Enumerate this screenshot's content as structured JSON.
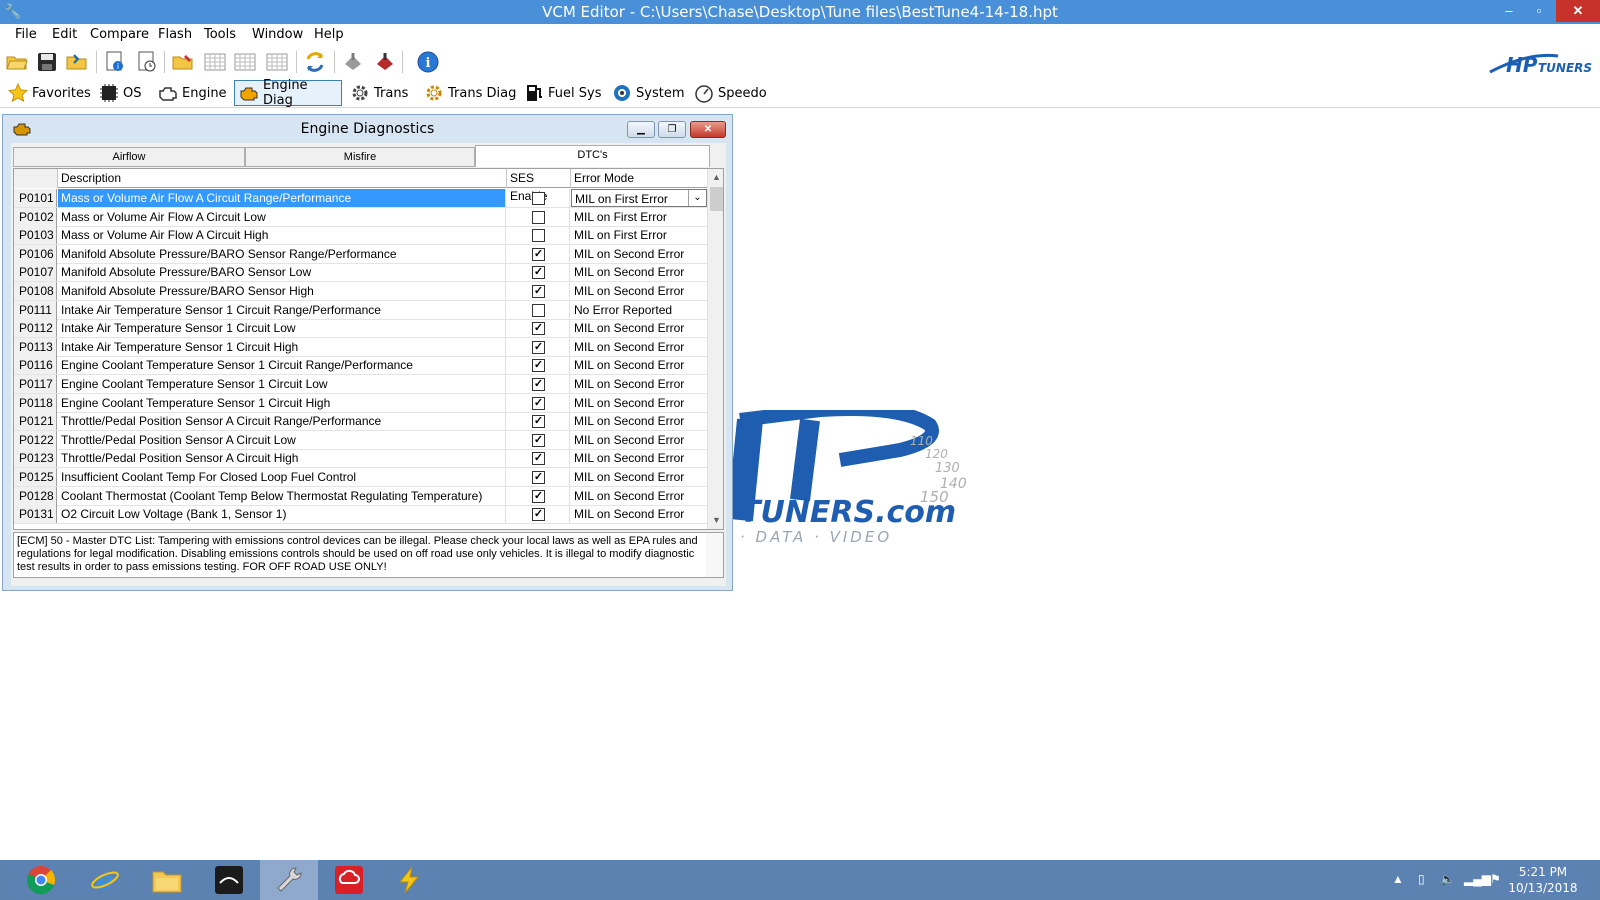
{
  "window": {
    "title": "VCM Editor - C:\\Users\\Chase\\Desktop\\Tune files\\BestTune4-14-18.hpt",
    "controls": [
      "–",
      "▫",
      "✕"
    ]
  },
  "menu": [
    "File",
    "Edit",
    "Compare",
    "Flash",
    "Tools",
    "Window",
    "Help"
  ],
  "brand": {
    "logo_text": "HPTUNERS",
    "accent": "#1a5fb4"
  },
  "nav": [
    {
      "label": "Favorites",
      "icon": "star-icon"
    },
    {
      "label": "OS",
      "icon": "chip-icon"
    },
    {
      "label": "Engine",
      "icon": "engine-icon"
    },
    {
      "label": "Engine Diag",
      "icon": "engine-check-icon",
      "active": true
    },
    {
      "label": "Trans",
      "icon": "gear-icon"
    },
    {
      "label": "Trans Diag",
      "icon": "gear-check-icon"
    },
    {
      "label": "Fuel Sys",
      "icon": "fuel-pump-icon"
    },
    {
      "label": "System",
      "icon": "system-icon"
    },
    {
      "label": "Speedo",
      "icon": "speedometer-icon"
    }
  ],
  "child": {
    "title": "Engine Diagnostics",
    "tabs": [
      "Airflow",
      "Misfire",
      "DTC's"
    ],
    "active_tab": "DTC's",
    "columns": {
      "code": "",
      "description": "Description",
      "ses": "SES Enable",
      "mode": "Error Mode"
    },
    "rows": [
      {
        "code": "P0101",
        "desc": "Mass or Volume Air Flow A Circuit Range/Performance",
        "ses": false,
        "mode": "MIL on First Error",
        "selected": true
      },
      {
        "code": "P0102",
        "desc": "Mass or Volume Air Flow A Circuit Low",
        "ses": false,
        "mode": "MIL on First Error"
      },
      {
        "code": "P0103",
        "desc": "Mass or Volume Air Flow A Circuit High",
        "ses": false,
        "mode": "MIL on First Error"
      },
      {
        "code": "P0106",
        "desc": "Manifold Absolute Pressure/BARO Sensor Range/Performance",
        "ses": true,
        "mode": "MIL on Second Error"
      },
      {
        "code": "P0107",
        "desc": "Manifold Absolute Pressure/BARO Sensor Low",
        "ses": true,
        "mode": "MIL on Second Error"
      },
      {
        "code": "P0108",
        "desc": "Manifold Absolute Pressure/BARO Sensor High",
        "ses": true,
        "mode": "MIL on Second Error"
      },
      {
        "code": "P0111",
        "desc": "Intake Air Temperature Sensor 1 Circuit Range/Performance",
        "ses": false,
        "mode": "No Error Reported"
      },
      {
        "code": "P0112",
        "desc": "Intake Air Temperature Sensor 1 Circuit Low",
        "ses": true,
        "mode": "MIL on Second Error"
      },
      {
        "code": "P0113",
        "desc": "Intake Air Temperature Sensor 1 Circuit High",
        "ses": true,
        "mode": "MIL on Second Error"
      },
      {
        "code": "P0116",
        "desc": "Engine Coolant Temperature Sensor 1 Circuit Range/Performance",
        "ses": true,
        "mode": "MIL on Second Error"
      },
      {
        "code": "P0117",
        "desc": "Engine Coolant Temperature Sensor 1 Circuit Low",
        "ses": true,
        "mode": "MIL on Second Error"
      },
      {
        "code": "P0118",
        "desc": "Engine Coolant Temperature Sensor 1 Circuit High",
        "ses": true,
        "mode": "MIL on Second Error"
      },
      {
        "code": "P0121",
        "desc": "Throttle/Pedal Position Sensor A Circuit Range/Performance",
        "ses": true,
        "mode": "MIL on Second Error"
      },
      {
        "code": "P0122",
        "desc": "Throttle/Pedal Position Sensor A Circuit Low",
        "ses": true,
        "mode": "MIL on Second Error"
      },
      {
        "code": "P0123",
        "desc": "Throttle/Pedal Position Sensor A Circuit High",
        "ses": true,
        "mode": "MIL on Second Error"
      },
      {
        "code": "P0125",
        "desc": "Insufficient Coolant Temp For Closed Loop Fuel Control",
        "ses": true,
        "mode": "MIL on Second Error"
      },
      {
        "code": "P0128",
        "desc": "Coolant Thermostat (Coolant Temp Below Thermostat Regulating Temperature)",
        "ses": true,
        "mode": "MIL on Second Error"
      },
      {
        "code": "P0131",
        "desc": "O2 Circuit Low Voltage (Bank 1, Sensor 1)",
        "ses": true,
        "mode": "MIL on Second Error"
      }
    ],
    "note": "[ECM] 50 - Master DTC List: Tampering with emissions control devices can be illegal. Please check your local laws as well as EPA rules and regulations for legal modification. Disabling emissions controls should be used on off road use only vehicles. It is illegal to modify diagnostic test results in order to pass emissions testing. FOR OFF ROAD USE ONLY!"
  },
  "watermark": {
    "text": "TUNERS.com",
    "tagline": "· DATA · VIDEO",
    "numbers": [
      "110",
      "120",
      "130",
      "140",
      "150"
    ]
  },
  "taskbar": {
    "apps": [
      "chrome-icon",
      "internet-explorer-icon",
      "file-explorer-icon",
      "app-dark-icon",
      "vcm-editor-icon",
      "creative-cloud-icon",
      "lightning-app-icon"
    ],
    "time": "5:21 PM",
    "date": "10/13/2018"
  }
}
